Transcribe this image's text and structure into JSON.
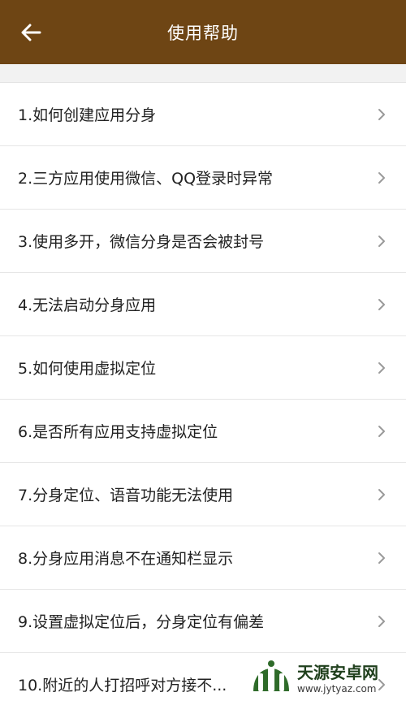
{
  "header": {
    "title": "使用帮助",
    "back_icon": "arrow-left-icon",
    "color": "#6e4514"
  },
  "help_items": [
    {
      "label": "1.如何创建应用分身"
    },
    {
      "label": "2.三方应用使用微信、QQ登录时异常"
    },
    {
      "label": "3.使用多开，微信分身是否会被封号"
    },
    {
      "label": "4.无法启动分身应用"
    },
    {
      "label": "5.如何使用虚拟定位"
    },
    {
      "label": "6.是否所有应用支持虚拟定位"
    },
    {
      "label": "7.分身定位、语音功能无法使用"
    },
    {
      "label": "8.分身应用消息不在通知栏显示"
    },
    {
      "label": "9.设置虚拟定位后，分身定位有偏差"
    },
    {
      "label": "10.附近的人打招呼对方接不..."
    }
  ],
  "watermark": {
    "name": "天源安卓网",
    "url": "www.jytyaz.com"
  }
}
